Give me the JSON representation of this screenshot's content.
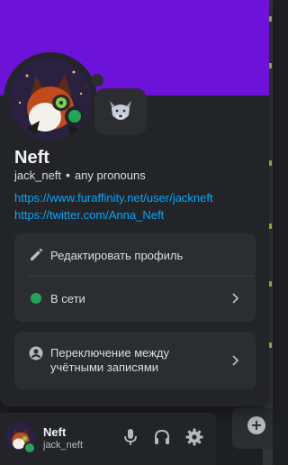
{
  "profile": {
    "display_name": "Neft",
    "username": "jack_neft",
    "pronouns": "any pronouns",
    "separator": "•",
    "links": [
      "https://www.furaffinity.net/user/jackneft",
      "https://twitter.com/Anna_Neft"
    ],
    "status_emoji": "🐺"
  },
  "menu": {
    "edit_profile": "Редактировать профиль",
    "online_status": "В сети",
    "switch_accounts": "Переключение между учётными записями"
  },
  "user_panel": {
    "name": "Neft",
    "username": "jack_neft"
  },
  "sidebar": {
    "add_label": "+"
  },
  "colors": {
    "banner": "#6d12d8",
    "online": "#23a55a",
    "link": "#00a8fc",
    "popout_bg": "#232428",
    "card_bg": "#2b2d31"
  }
}
